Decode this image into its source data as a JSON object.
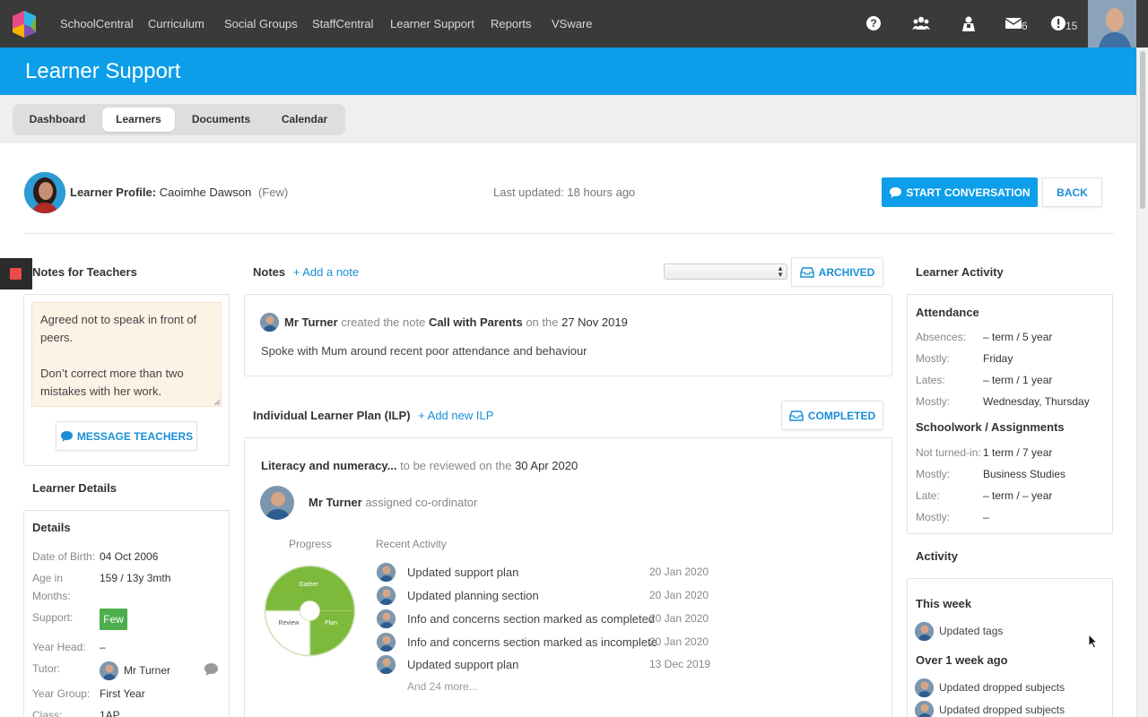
{
  "topnav": {
    "items": [
      "SchoolCentral",
      "Curriculum",
      "Social Groups",
      "StaffCentral",
      "Learner Support",
      "Reports",
      "VSware"
    ],
    "icons": [
      "help-icon",
      "groups-icon",
      "user-icon",
      "mail-icon",
      "alert-icon"
    ],
    "mail_count": "6",
    "alert_count": "15"
  },
  "banner": {
    "title": "Learner Support"
  },
  "tabs": [
    "Dashboard",
    "Learners",
    "Documents",
    "Calendar"
  ],
  "active_tab": "Learners",
  "profile": {
    "label": "Learner Profile:",
    "name": "Caoimhe Dawson",
    "support_tag": "(Few)",
    "last_updated": "Last updated: 18 hours ago",
    "start_conversation": "START CONVERSATION",
    "back": "BACK"
  },
  "notes_for_teachers": {
    "title": "Notes for Teachers",
    "text": "Agreed not to speak in front of peers.\n\nDon’t correct more than two mistakes with her work.",
    "message_button": "MESSAGE TEACHERS"
  },
  "learner_details": {
    "title": "Learner Details",
    "card_title": "Details",
    "dob_label": "Date of Birth:",
    "dob": "04 Oct 2006",
    "age_label": "Age in Months:",
    "age": "159 / 13y 3mth",
    "support_label": "Support:",
    "support": "Few",
    "year_head_label": "Year Head:",
    "year_head": "–",
    "tutor_label": "Tutor:",
    "tutor": "Mr Turner",
    "year_group_label": "Year Group:",
    "year_group": "First Year",
    "class_label": "Class:",
    "class": "1AP"
  },
  "notes": {
    "title": "Notes",
    "add_link": "+ Add a note",
    "archived_button": "ARCHIVED",
    "author": "Mr Turner",
    "action": "created the note",
    "note_title": "Call with Parents",
    "on_the": "on the",
    "date": "27 Nov 2019",
    "body": "Spoke with Mum around recent poor attendance and behaviour"
  },
  "ilp": {
    "title": "Individual Learner Plan (ILP)",
    "add_link": "+ Add new ILP",
    "completed_button": "COMPLETED",
    "plan_name": "Literacy and numeracy...",
    "review_text": "to be reviewed on the",
    "review_date": "30 Apr 2020",
    "coordinator": "Mr Turner",
    "coordinator_role": "assigned co-ordinator",
    "progress_label": "Progress",
    "recent_label": "Recent Activity",
    "progress_segments": [
      "Gather",
      "Plan",
      "Review"
    ],
    "activities": [
      {
        "text": "Updated support plan",
        "date": "20 Jan 2020"
      },
      {
        "text": "Updated planning section",
        "date": "20 Jan 2020"
      },
      {
        "text": "Info and concerns section marked as completed",
        "date": "20 Jan 2020"
      },
      {
        "text": "Info and concerns section marked as incomplete",
        "date": "20 Jan 2020"
      },
      {
        "text": "Updated support plan",
        "date": "13 Dec 2019"
      }
    ],
    "more": "And 24 more..."
  },
  "learner_activity": {
    "title": "Learner Activity",
    "attendance_title": "Attendance",
    "absences_label": "Absences:",
    "absences": "– term / 5 year",
    "mostly_label": "Mostly:",
    "absences_mostly": "Friday",
    "lates_label": "Lates:",
    "lates": "– term / 1 year",
    "lates_mostly": "Wednesday, Thursday",
    "schoolwork_title": "Schoolwork / Assignments",
    "not_turned_label": "Not turned-in:",
    "not_turned": "1 term / 7 year",
    "not_turned_mostly": "Business Studies",
    "late_label": "Late:",
    "late": "– term / – year",
    "late_mostly": "–",
    "activity_title": "Activity",
    "this_week": "This week",
    "this_week_items": [
      "Updated tags"
    ],
    "over_week": "Over 1 week ago",
    "over_week_items": [
      "Updated dropped subjects",
      "Updated dropped subjects"
    ]
  },
  "colors": {
    "brand_blue": "#0c9ee9",
    "nav_bg": "#3a3a3a",
    "support_green": "#4cae4c",
    "progress_green": "#7dba3c"
  }
}
